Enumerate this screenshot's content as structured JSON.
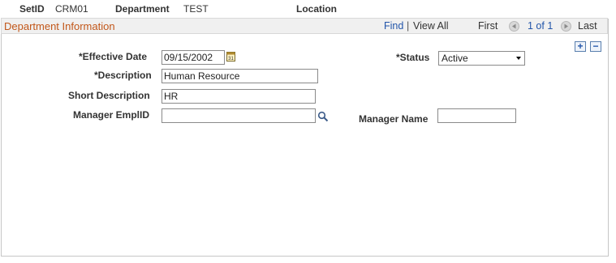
{
  "header": {
    "setid_label": "SetID",
    "setid_value": "CRM01",
    "department_label": "Department",
    "department_value": "TEST",
    "location_label": "Location"
  },
  "panel": {
    "title": "Department Information",
    "find_label": "Find",
    "separator": "|",
    "view_all_label": "View All",
    "first_label": "First",
    "page_indicator": "1 of 1",
    "last_label": "Last",
    "add_button": "+",
    "remove_button": "−"
  },
  "form": {
    "effective_date_label": "*Effective Date",
    "effective_date_value": "09/15/2002",
    "calendar_icon_text": "31",
    "status_label": "*Status",
    "status_value": "Active",
    "description_label": "*Description",
    "description_value": "Human Resource",
    "short_description_label": "Short Description",
    "short_description_value": "HR",
    "manager_emplid_label": "Manager EmplID",
    "manager_emplid_value": "",
    "manager_name_label": "Manager Name",
    "manager_name_value": ""
  },
  "icons": {
    "prev": "left-arrow-circle-icon",
    "next": "right-arrow-circle-icon",
    "calendar": "calendar-icon",
    "lookup": "magnifier-lookup-icon"
  },
  "colors": {
    "panel_title": "#c2571a",
    "link": "#2255aa",
    "panel_header_bg": "#f0f0f0"
  }
}
